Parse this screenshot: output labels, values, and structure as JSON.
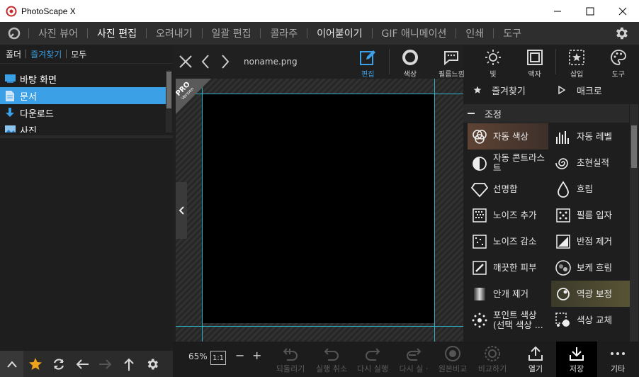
{
  "window": {
    "title": "PhotoScape X"
  },
  "menu": {
    "items": [
      "사진 뷰어",
      "사진 편집",
      "오려내기",
      "일괄 편집",
      "콜라주",
      "이어붙이기",
      "GIF 애니메이션",
      "인쇄",
      "도구"
    ]
  },
  "left": {
    "tabs": [
      "폴더",
      "즐겨찾기",
      "모두"
    ],
    "tree": [
      "바탕 화면",
      "문서",
      "다운로드",
      "사진"
    ]
  },
  "editor": {
    "filename": "noname.png",
    "pro_badge": "PRO",
    "pro_sub": "Version"
  },
  "tools": [
    "편집",
    "색상",
    "필름느낌",
    "빛",
    "액자",
    "삽입",
    "도구"
  ],
  "right": {
    "header": [
      "즐겨찾기",
      "매크로"
    ],
    "section": "조정",
    "filters": [
      "자동 색상",
      "자동 레벨",
      "자동 콘트라스트",
      "초현실적",
      "선명함",
      "흐림",
      "노이즈 추가",
      "필름 입자",
      "노이즈 감소",
      "반점 제거",
      "깨끗한 피부",
      "보케 흐림",
      "안개 제거",
      "역광 보정",
      "포인트 색상 (선택 색상 ...",
      "색상 교체"
    ]
  },
  "bottom": {
    "zoom": "65%",
    "one_to_one": "1:1",
    "minus": "−",
    "plus": "+",
    "actions": [
      "되돌리기",
      "실행 취소",
      "다시 실행",
      "다시 실 ·",
      "원본비교",
      "비교하기"
    ],
    "open": "열기",
    "save": "저장",
    "more": "기타"
  },
  "colors": {
    "accent": "#3ca0e6",
    "guide": "#2ab3c9"
  }
}
